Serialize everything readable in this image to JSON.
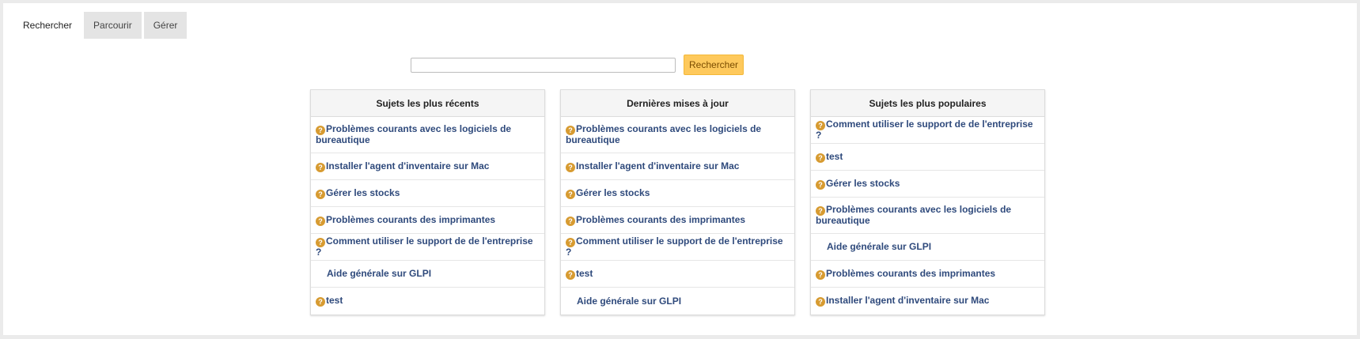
{
  "tabs": [
    {
      "label": "Rechercher",
      "active": true
    },
    {
      "label": "Parcourir",
      "active": false
    },
    {
      "label": "Gérer",
      "active": false
    }
  ],
  "search": {
    "value": "",
    "button_label": "Rechercher"
  },
  "columns": [
    {
      "title": "Sujets les plus récents",
      "items": [
        {
          "label": "Problèmes courants avec les logiciels de bureautique",
          "icon": "question-icon"
        },
        {
          "label": "Installer l'agent d'inventaire sur Mac",
          "icon": "question-icon"
        },
        {
          "label": "Gérer les stocks",
          "icon": "question-icon"
        },
        {
          "label": "Problèmes courants des imprimantes",
          "icon": "question-icon"
        },
        {
          "label": "Comment utiliser le support de de l'entreprise ?",
          "icon": "question-icon"
        },
        {
          "label": "Aide générale sur GLPI",
          "icon": null
        },
        {
          "label": "test",
          "icon": "question-icon"
        }
      ]
    },
    {
      "title": "Dernières mises à jour",
      "items": [
        {
          "label": "Problèmes courants avec les logiciels de bureautique",
          "icon": "question-icon"
        },
        {
          "label": "Installer l'agent d'inventaire sur Mac",
          "icon": "question-icon"
        },
        {
          "label": "Gérer les stocks",
          "icon": "question-icon"
        },
        {
          "label": "Problèmes courants des imprimantes",
          "icon": "question-icon"
        },
        {
          "label": "Comment utiliser le support de de l'entreprise ?",
          "icon": "question-icon"
        },
        {
          "label": "test",
          "icon": "question-icon"
        },
        {
          "label": "Aide générale sur GLPI",
          "icon": null
        }
      ]
    },
    {
      "title": "Sujets les plus populaires",
      "items": [
        {
          "label": "Comment utiliser le support de de l'entreprise ?",
          "icon": "question-icon"
        },
        {
          "label": "test",
          "icon": "question-icon"
        },
        {
          "label": "Gérer les stocks",
          "icon": "question-icon"
        },
        {
          "label": "Problèmes courants avec les logiciels de bureautique",
          "icon": "question-icon"
        },
        {
          "label": "Aide générale sur GLPI",
          "icon": null
        },
        {
          "label": "Problèmes courants des imprimantes",
          "icon": "question-icon"
        },
        {
          "label": "Installer l'agent d'inventaire sur Mac",
          "icon": "question-icon"
        }
      ]
    }
  ],
  "colors": {
    "link": "#2f4a7c",
    "icon": "#d79b31",
    "button": "#fec95c"
  }
}
